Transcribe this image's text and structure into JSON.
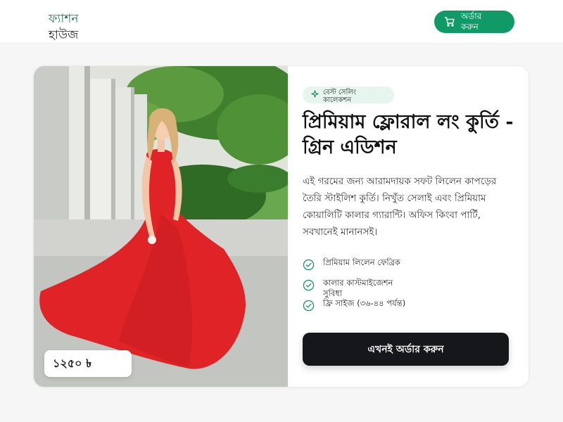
{
  "header": {
    "brand_line1": "ফ্যাশন",
    "brand_line2": "হাউজ",
    "order_button": "অর্ডার করুন",
    "order_icon": "cart-icon"
  },
  "product": {
    "image_alt": "red-dress-model-photo",
    "price": "১২৫০ ৳",
    "badge": "বেস্ট সেলিং কালেকশন",
    "badge_icon": "sparkle-icon",
    "title": "প্রিমিয়াম ফ্লোরাল লং কুর্তি - গ্রিন এডিশন",
    "description": "এই গরমের জন্য আরামদায়ক সফট লিলেন কাপড়ের তৈরি স্টাইলিশ কুর্তি। নিখুঁত সেলাই এবং প্রিমিয়াম কোয়ালিটি কালার গ্যারান্টি। অফিস কিংবা পার্টি, সবখানেই মানানসই।",
    "features": [
      {
        "label": "প্রিমিয়াম লিলেন ফেব্রিক",
        "icon": "check-circle-icon"
      },
      {
        "label": "কালার কাস্টমাইজেশন সুবিধা",
        "icon": "check-circle-icon"
      },
      {
        "label": "ফ্রি সাইজ (৩৬-৪৪ পর্যন্ত)",
        "icon": "check-circle-icon"
      }
    ],
    "cta": "এখনই অর্ডার করুন"
  },
  "colors": {
    "accent": "#0f9a68",
    "brand_green": "#1a7a55",
    "cta_bg": "#16171a",
    "badge_bg": "#e6f6ee",
    "dress_red": "#e02327"
  }
}
